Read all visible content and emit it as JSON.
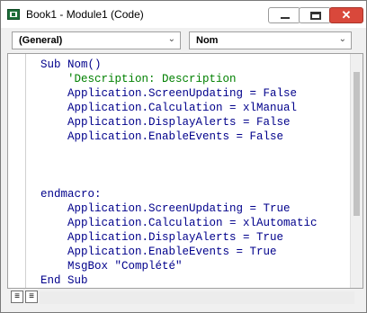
{
  "window": {
    "title": "Book1 - Module1 (Code)",
    "accent_close": "#d9483b"
  },
  "toolbar": {
    "object_dropdown": "(General)",
    "procedure_dropdown": "Nom"
  },
  "code": {
    "lines": [
      {
        "indent": "",
        "parts": [
          {
            "t": "Sub Nom()",
            "c": "kw"
          }
        ]
      },
      {
        "indent": "    ",
        "parts": [
          {
            "t": "'Description: Description",
            "c": "cm"
          }
        ]
      },
      {
        "indent": "    ",
        "parts": [
          {
            "t": "Application.ScreenUpdating = False",
            "c": "tx"
          }
        ]
      },
      {
        "indent": "    ",
        "parts": [
          {
            "t": "Application.Calculation = xlManual",
            "c": "tx"
          }
        ]
      },
      {
        "indent": "    ",
        "parts": [
          {
            "t": "Application.DisplayAlerts = False",
            "c": "tx"
          }
        ]
      },
      {
        "indent": "    ",
        "parts": [
          {
            "t": "Application.EnableEvents = False",
            "c": "tx"
          }
        ]
      },
      {
        "indent": "",
        "parts": []
      },
      {
        "indent": "",
        "parts": []
      },
      {
        "indent": "",
        "parts": []
      },
      {
        "indent": "",
        "parts": [
          {
            "t": "endmacro:",
            "c": "tx"
          }
        ]
      },
      {
        "indent": "    ",
        "parts": [
          {
            "t": "Application.ScreenUpdating = True",
            "c": "tx"
          }
        ]
      },
      {
        "indent": "    ",
        "parts": [
          {
            "t": "Application.Calculation = xlAutomatic",
            "c": "tx"
          }
        ]
      },
      {
        "indent": "    ",
        "parts": [
          {
            "t": "Application.DisplayAlerts = True",
            "c": "tx"
          }
        ]
      },
      {
        "indent": "    ",
        "parts": [
          {
            "t": "Application.EnableEvents = True",
            "c": "tx"
          }
        ]
      },
      {
        "indent": "    ",
        "parts": [
          {
            "t": "MsgBox \"Complété\"",
            "c": "tx"
          }
        ]
      },
      {
        "indent": "",
        "parts": [
          {
            "t": "End Sub",
            "c": "kw"
          }
        ]
      }
    ]
  },
  "icons": {
    "app": "excel-app-icon",
    "minimize": "minimize-icon",
    "maximize": "maximize-icon",
    "close": "close-icon",
    "dropdown": "chevron-down-icon",
    "procedure_view": "procedure-view-icon",
    "module_view": "full-module-view-icon"
  }
}
